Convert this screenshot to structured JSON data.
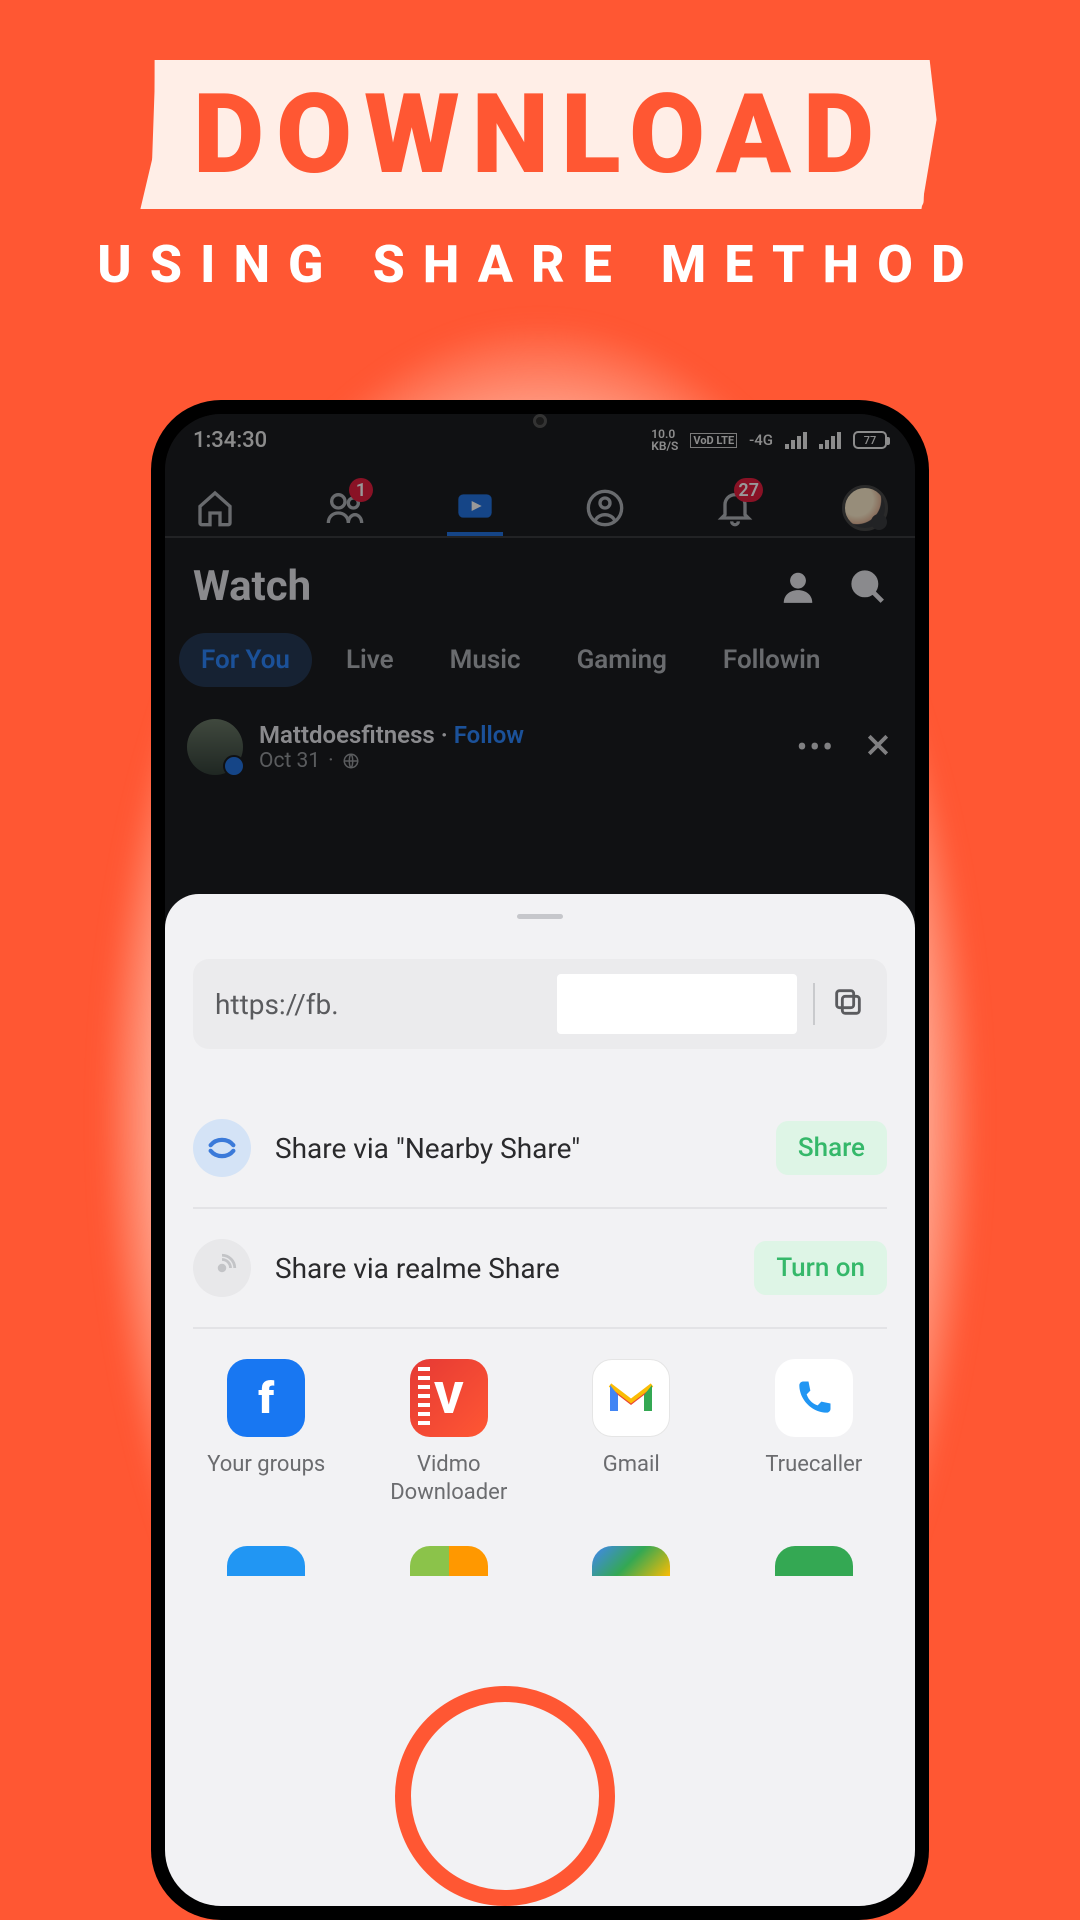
{
  "banner": {
    "title": "DOWNLOAD",
    "subtitle": "USING SHARE METHOD"
  },
  "status": {
    "time": "1:34:30",
    "speed_num": "10.0",
    "speed_unit": "KB/S",
    "lte": "VoD LTE",
    "net": "-4G",
    "battery": "77"
  },
  "fb": {
    "friends_badge": "1",
    "notif_badge": "27",
    "watch_title": "Watch",
    "tabs": [
      "For You",
      "Live",
      "Music",
      "Gaming",
      "Followin"
    ],
    "post": {
      "name": "Mattdoesfitness",
      "follow": "Follow",
      "date": "Oct 31"
    }
  },
  "sheet": {
    "url": "https://fb.",
    "nearby_label": "Share via \"Nearby Share\"",
    "nearby_action": "Share",
    "realme_label": "Share via realme Share",
    "realme_action": "Turn on",
    "apps": [
      {
        "label": "Your groups"
      },
      {
        "label": "Vidmo Downloader"
      },
      {
        "label": "Gmail"
      },
      {
        "label": "Truecaller"
      }
    ]
  }
}
